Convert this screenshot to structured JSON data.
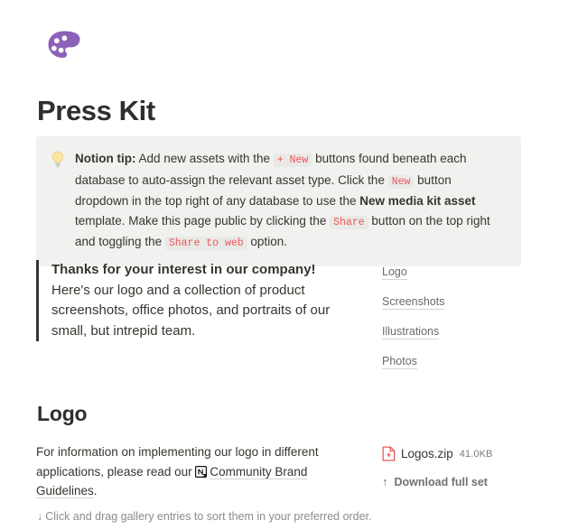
{
  "page": {
    "icon_name": "artist-palette-emoji",
    "title": "Press Kit"
  },
  "callout": {
    "icon_name": "light-bulb-emoji",
    "lead_bold": "Notion tip:",
    "t1": " Add new assets with the ",
    "code1": "+ New",
    "t2": " buttons found beneath each database to auto-assign the relevant asset type. Click the ",
    "code2": "New",
    "t3": " button dropdown in the top right of any database to use the ",
    "bold2": "New media kit asset",
    "t4": " template. Make this page public by clicking the ",
    "code3": "Share",
    "t5": " button on the top right and toggling the ",
    "code4": "Share to web",
    "t6": " option."
  },
  "quote": {
    "heading": "Thanks for your interest in our company!",
    "body": "Here's our logo and a collection of product screenshots, office photos, and portraits of our small, but intrepid team."
  },
  "toc": {
    "items": [
      {
        "label": "Logo"
      },
      {
        "label": "Screenshots"
      },
      {
        "label": "Illustrations"
      },
      {
        "label": "Photos"
      }
    ]
  },
  "logo_section": {
    "title": "Logo",
    "text_before": "For information on implementing our logo in different applications, please read our ",
    "link_icon_name": "notion-page-link-icon",
    "link_label": "Community Brand Guidelines",
    "text_after": ".",
    "file": {
      "icon_name": "zip-file-icon",
      "name": "Logos.zip",
      "size": "41.0KB"
    },
    "download": {
      "arrow": "↑",
      "label": "Download full set"
    }
  },
  "hint": {
    "arrow": "↓",
    "text": "Click and drag gallery entries to sort them in your preferred order."
  },
  "colors": {
    "accent_purple": "#8b62b8",
    "code_red": "#eb5757",
    "callout_bg": "#f1f1ef",
    "text": "#37352f",
    "muted": "#8c8b87"
  }
}
